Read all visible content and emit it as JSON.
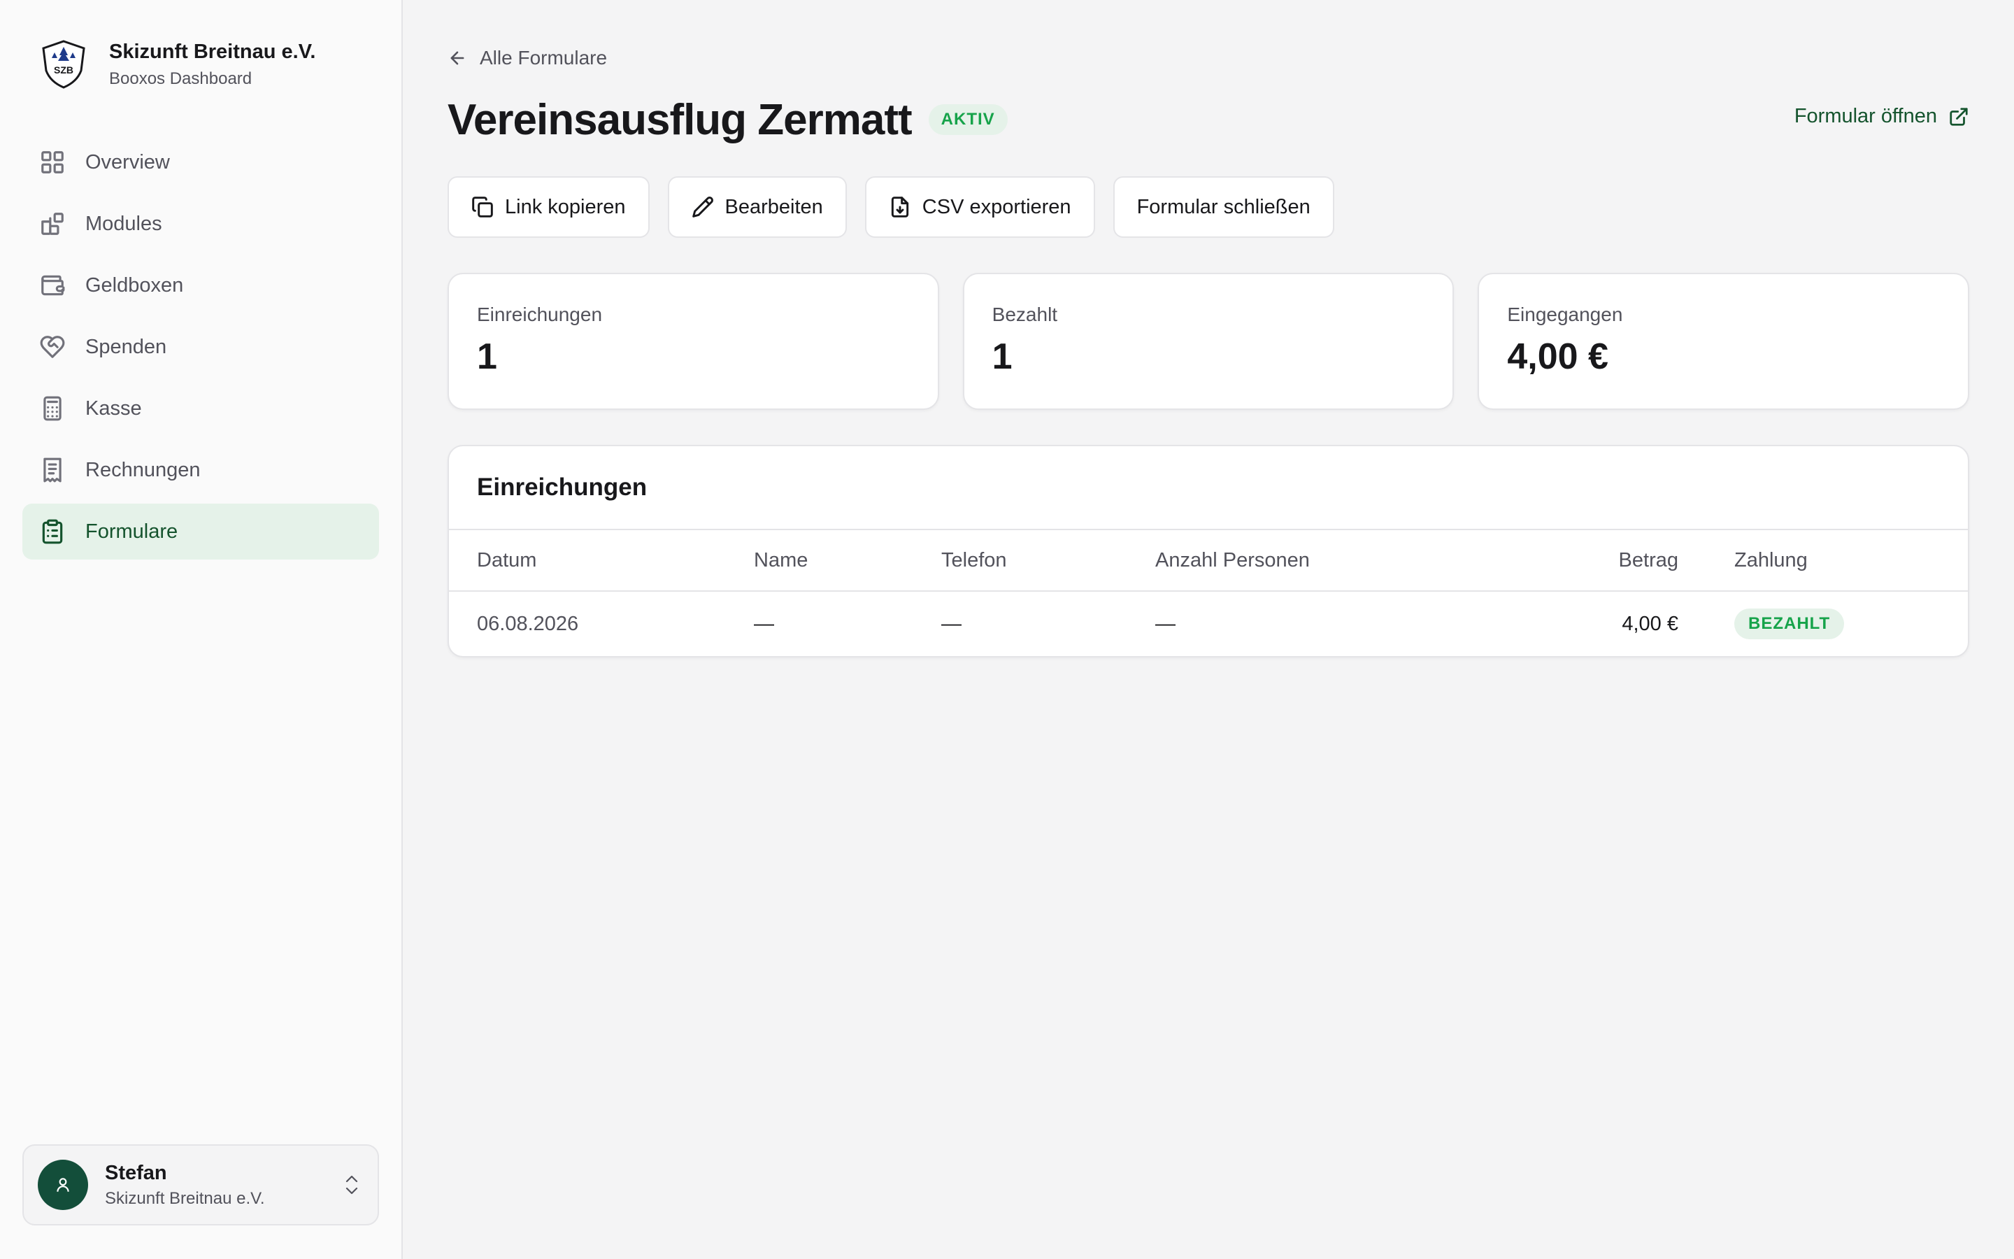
{
  "brand": {
    "name": "Skizunft Breitnau e.V.",
    "subtitle": "Booxos Dashboard",
    "logo_text": "SZB"
  },
  "sidebar": {
    "items": [
      {
        "label": "Overview",
        "icon": "grid-icon",
        "active": false
      },
      {
        "label": "Modules",
        "icon": "modules-icon",
        "active": false
      },
      {
        "label": "Geldboxen",
        "icon": "wallet-icon",
        "active": false
      },
      {
        "label": "Spenden",
        "icon": "heart-handshake-icon",
        "active": false
      },
      {
        "label": "Kasse",
        "icon": "calculator-icon",
        "active": false
      },
      {
        "label": "Rechnungen",
        "icon": "receipt-icon",
        "active": false
      },
      {
        "label": "Formulare",
        "icon": "clipboard-list-icon",
        "active": true
      }
    ]
  },
  "user": {
    "name": "Stefan",
    "org": "Skizunft Breitnau e.V."
  },
  "page": {
    "back_label": "Alle Formulare",
    "title": "Vereinsausflug Zermatt",
    "status_badge": "AKTIV",
    "open_link": "Formular öffnen"
  },
  "actions": {
    "copy_link": "Link kopieren",
    "edit": "Bearbeiten",
    "export_csv": "CSV exportieren",
    "close_form": "Formular schließen"
  },
  "stats": {
    "submissions_label": "Einreichungen",
    "submissions_value": "1",
    "paid_label": "Bezahlt",
    "paid_value": "1",
    "received_label": "Eingegangen",
    "received_value": "4,00 €"
  },
  "table": {
    "title": "Einreichungen",
    "headers": {
      "date": "Datum",
      "name": "Name",
      "phone": "Telefon",
      "persons": "Anzahl Personen",
      "amount": "Betrag",
      "payment": "Zahlung"
    },
    "rows": [
      {
        "date": "06.08.2026",
        "name": "—",
        "phone": "—",
        "persons": "—",
        "amount": "4,00 €",
        "payment": "BEZAHLT"
      }
    ]
  },
  "colors": {
    "accent": "#14532d",
    "accent_bg": "#e5f2e9",
    "success": "#16a34a",
    "avatar": "#134e3a"
  }
}
